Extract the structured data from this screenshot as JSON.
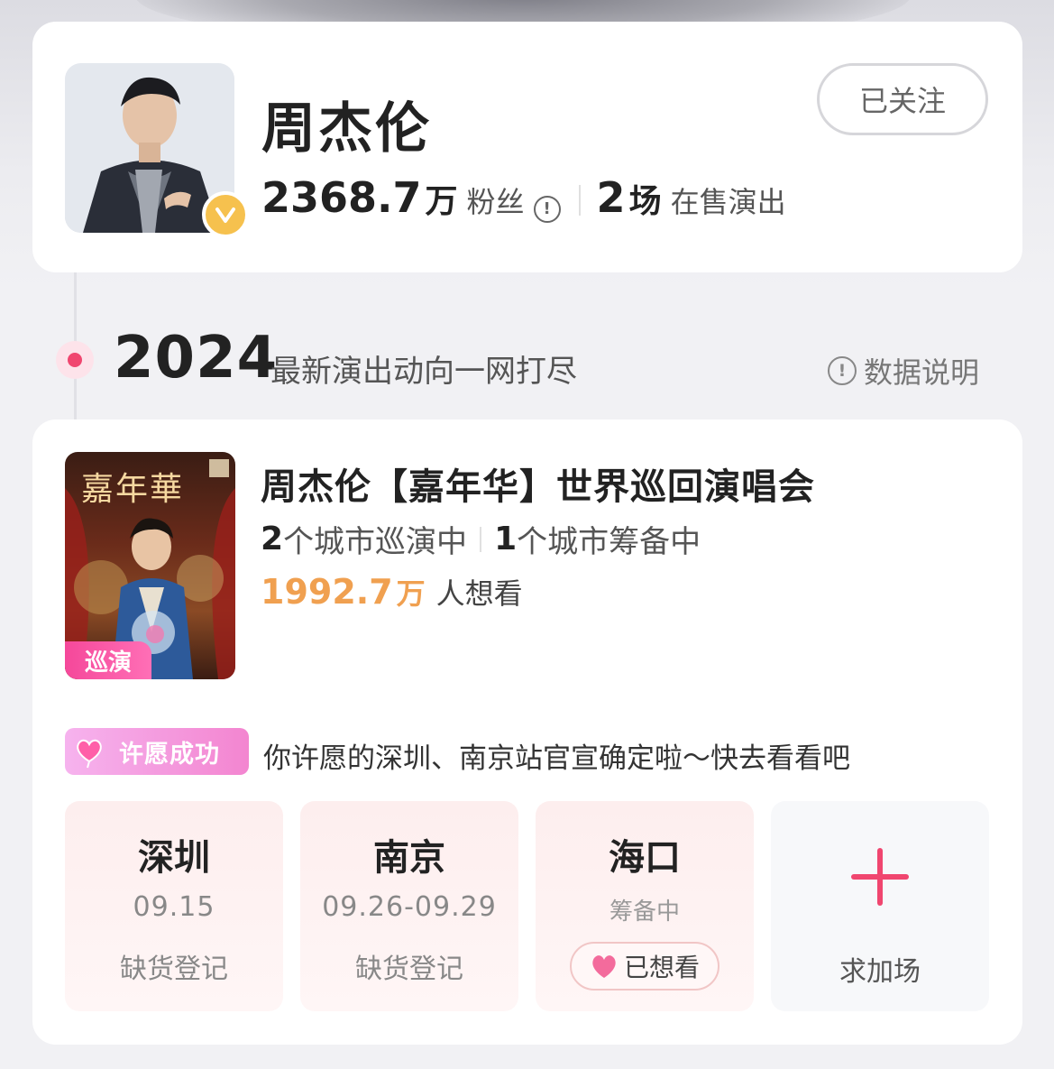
{
  "artist": {
    "name": "周杰伦",
    "follow_label": "已关注",
    "fans_count": "2368.7",
    "fans_unit": "万",
    "fans_label": "粉丝",
    "shows_count": "2",
    "shows_unit": "场",
    "shows_label": "在售演出",
    "verified_icon": "verified-v-icon"
  },
  "timeline": {
    "year": "2024",
    "subtitle": "最新演出动向一网打尽",
    "data_note": "数据说明"
  },
  "tour": {
    "poster_art_text": "嘉年華",
    "tag": "巡演",
    "title": "周杰伦【嘉年华】世界巡回演唱会",
    "touring_count": "2",
    "touring_label": "个城市巡演中",
    "preparing_count": "1",
    "preparing_label": "个城市筹备中",
    "want_count": "1992.7",
    "want_unit": "万",
    "want_label": "人想看",
    "wish_badge": "许愿成功",
    "wish_message": "你许愿的深圳、南京站官宣确定啦～快去看看吧",
    "cities": [
      {
        "name": "深圳",
        "date": "09.15",
        "status": "缺货登记"
      },
      {
        "name": "南京",
        "date": "09.26-09.29",
        "status": "缺货登记"
      },
      {
        "name": "海口",
        "state": "筹备中",
        "button": "已想看"
      }
    ],
    "add_show_label": "求加场"
  },
  "colors": {
    "accent": "#f0466f",
    "orange": "#f0a050",
    "badge_pink": "#f385d0",
    "verified": "#f6c14e"
  }
}
